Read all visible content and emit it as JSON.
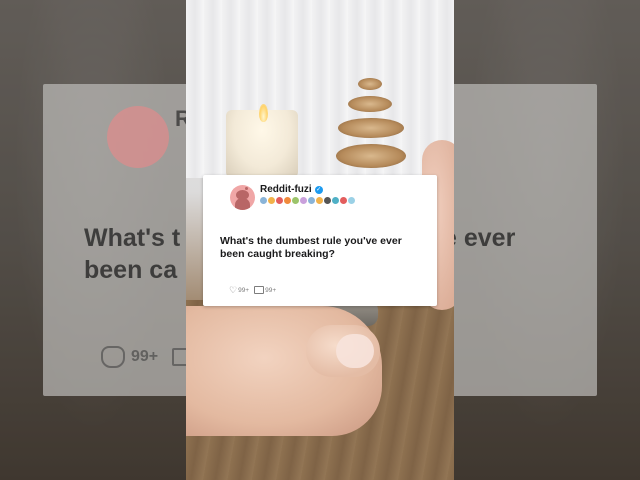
{
  "post": {
    "username": "Reddit-fuzi",
    "verified_badge": "✓",
    "title": "What's the dumbest rule you've ever been caught breaking?",
    "likes": "99+",
    "comments": "99+",
    "awards": [
      "#8ab4d8",
      "#f2b24a",
      "#e35d5d",
      "#f08a3c",
      "#9bc46a",
      "#c9a0dc",
      "#8ab4d8",
      "#f2b24a",
      "#555555",
      "#4fb0c6",
      "#e35d5d",
      "#9bd1e6"
    ]
  },
  "background_card": {
    "name_fragment": "R",
    "question_line1": "What's t",
    "question_line1_end": "ve ever",
    "question_line2": "been ca",
    "likes": "99+"
  },
  "colors": {
    "avatar": "#f0a6a6",
    "verified": "#1d9bf0",
    "card": "#ffffff"
  }
}
